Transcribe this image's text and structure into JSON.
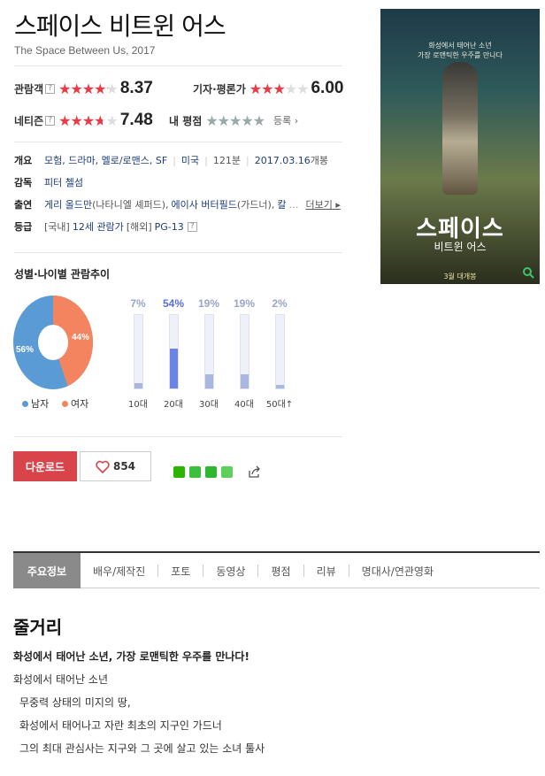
{
  "movie": {
    "title": "스페이스 비트윈 어스",
    "subtitle": "The Space Between Us, 2017"
  },
  "ratings": {
    "audience": {
      "label": "관람객",
      "score": "8.37",
      "stars_fraction": 0.837
    },
    "critic": {
      "label": "기자·평론가",
      "score": "6.00",
      "stars_fraction": 0.6
    },
    "netizen": {
      "label": "네티즌",
      "score": "7.48",
      "stars_fraction": 0.748
    },
    "mine": {
      "label": "내 평점",
      "stars_fraction": 1.0,
      "register_label": "등록"
    },
    "help_mark": "?"
  },
  "info": {
    "overview_label": "개요",
    "genres": "모험, 드라마, 멜로/로맨스, SF",
    "country": "미국",
    "runtime": "121분",
    "release_date": "2017.03.16",
    "release_suffix": "개봉",
    "director_label": "감독",
    "director": "피터 첼섬",
    "cast_label": "출연",
    "cast1_name": "게리 올드만",
    "cast1_role": "(나타니엘 셰퍼드),",
    "cast2_name": "에이사 버터필드",
    "cast2_role": "(가드너),",
    "cast3_trunc": "칼",
    "ellipsis": "…",
    "more": "더보기",
    "rating_label": "등급",
    "domestic_tag": "[국내]",
    "domestic_rating": "12세 관람가",
    "overseas_tag": "[해외]",
    "overseas_rating": "PG-13"
  },
  "poster": {
    "tagline1": "화성에서 태어난 소년",
    "tagline2": "가장 로맨틱한 우주를 만나다",
    "title": "스페이스",
    "subtitle": "비트윈 어스",
    "release": "3월 대개봉",
    "icon": "search-icon"
  },
  "demographics": {
    "title": "성별·나이별 관람추이",
    "gender": {
      "male_pct": 56,
      "female_pct": 44,
      "male_label": "56%",
      "female_label": "44%",
      "male_legend": "남자",
      "female_legend": "여자",
      "male_color": "#5b9bd5",
      "female_color": "#f4845f"
    },
    "ages": [
      {
        "label": "10대",
        "pct": 7,
        "pct_label": "7%"
      },
      {
        "label": "20대",
        "pct": 54,
        "pct_label": "54%"
      },
      {
        "label": "30대",
        "pct": 19,
        "pct_label": "19%"
      },
      {
        "label": "40대",
        "pct": 19,
        "pct_label": "19%"
      },
      {
        "label": "50대↑",
        "pct": 2,
        "pct_label": "2%"
      }
    ]
  },
  "actions": {
    "download_label": "다운로드",
    "like_count": "854",
    "icons": [
      "naver-band-icon",
      "kakao-icon",
      "bookmark-icon",
      "line-icon",
      "share-icon"
    ]
  },
  "tabs": [
    "주요정보",
    "배우/제작진",
    "포토",
    "동영상",
    "평점",
    "리뷰",
    "명대사/연관영화"
  ],
  "story": {
    "heading": "줄거리",
    "headline": "화성에서 태어난 소년, 가장 로맨틱한 우주를 만나다!",
    "lines": [
      "화성에서 태어난 소년",
      "무중력 상태의 미지의 땅,",
      "화성에서 태어나고 자란 최초의 지구인 가드너",
      "그의 최대 관심사는 지구와 그 곳에 살고 있는 소녀 툴사"
    ]
  }
}
